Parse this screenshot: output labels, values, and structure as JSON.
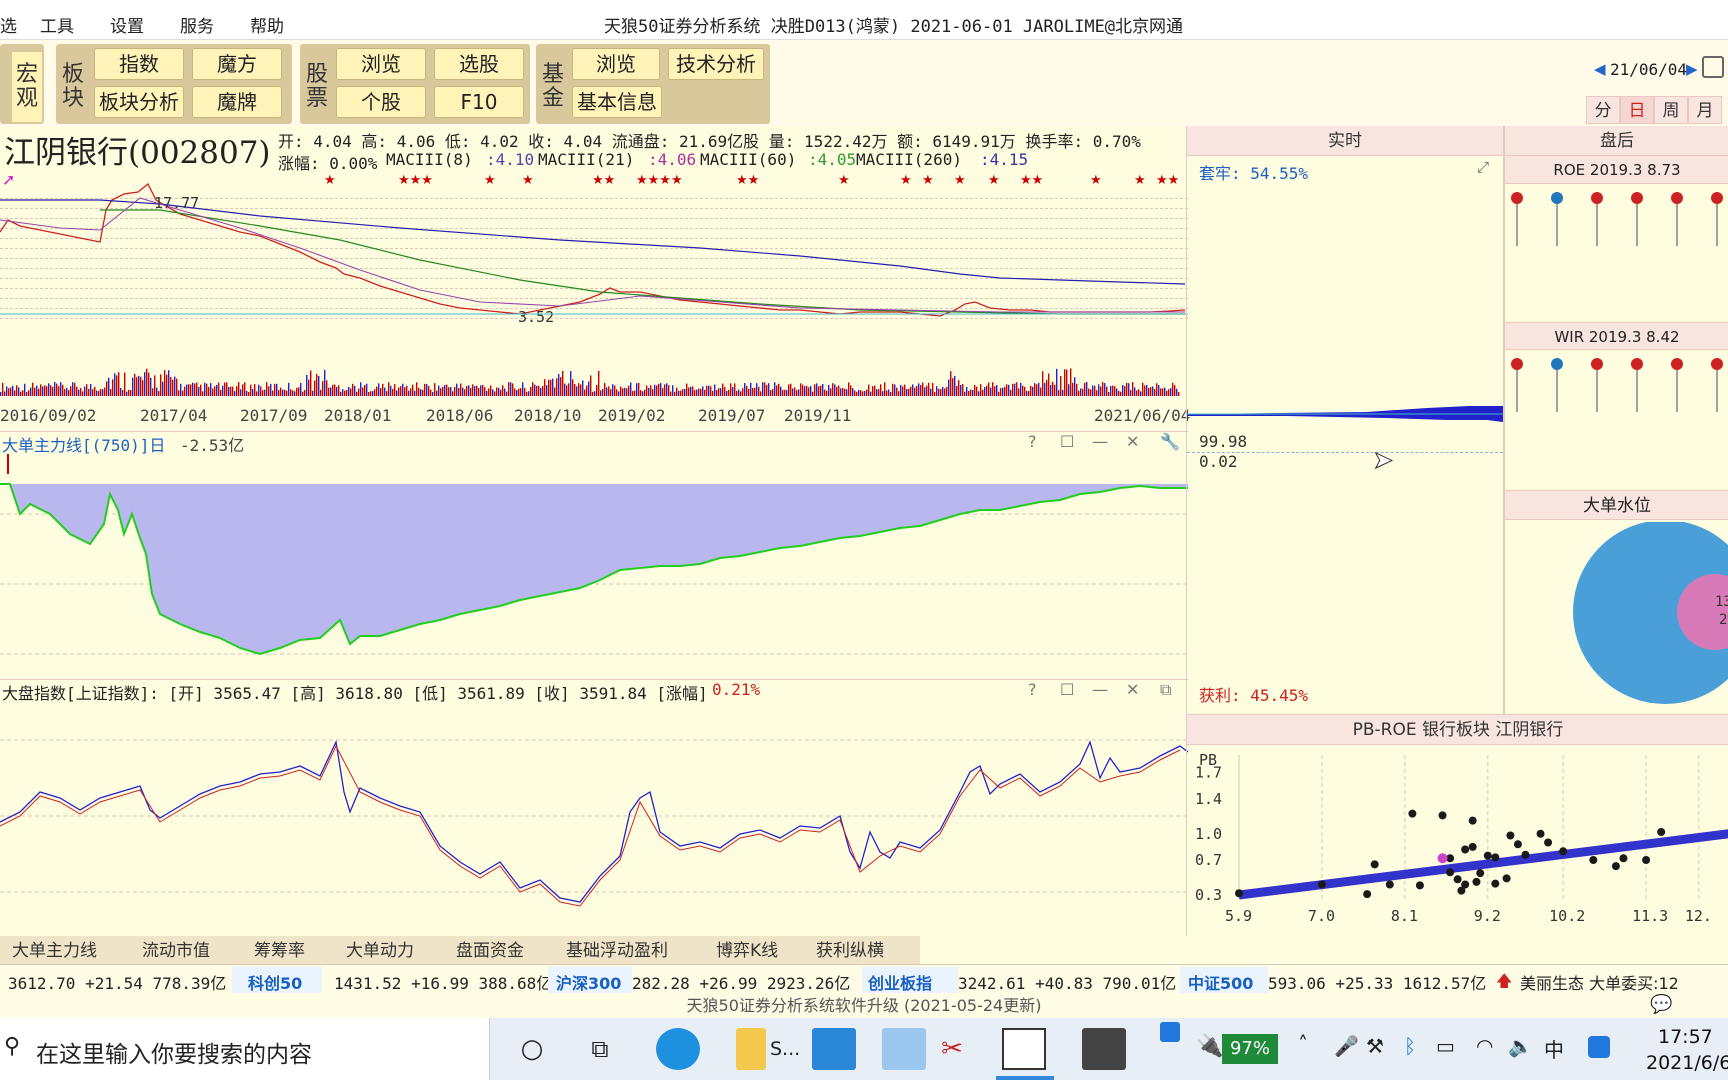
{
  "menu": {
    "items": [
      "工具",
      "设置",
      "服务",
      "帮助"
    ],
    "title": "天狼50证券分析系统  决胜D013(鸿蒙)  2021-06-01 JAROLIME@北京网通"
  },
  "toolbar": {
    "macro_label": "宏观",
    "sector_label": "板块",
    "btn_index": "指数",
    "btn_cube": "魔方",
    "btn_sector_analysis": "板块分析",
    "btn_magic_card": "魔牌",
    "stock_label": "股票",
    "btn_browse": "浏览",
    "btn_select": "选股",
    "btn_single": "个股",
    "btn_f10": "F10",
    "fund_label": "基金",
    "btn_fund_browse": "浏览",
    "btn_tech": "技术分析",
    "btn_basic_info": "基本信息",
    "date_nav": "21/06/04",
    "periods": [
      "分",
      "日",
      "周",
      "月"
    ]
  },
  "stock": {
    "name": "江阴银行(002807)",
    "line1": "开: 4.04 高: 4.06 低: 4.02 收: 4.04 流通盘: 21.69亿股 量: 1522.42万 额: 6149.91万 换手率: 0.70%",
    "change": "涨幅: 0.00%",
    "ma8_label": "MACIII(8)",
    "ma8_val": ":4.10",
    "ma21_label": "MACIII(21)",
    "ma21_val": ":4.06",
    "ma60_label": "MACIII(60)",
    "ma60_val": ":4.05",
    "ma260_label": "MACIII(260)",
    "ma260_val": ":4.15",
    "high_label": "17.77",
    "low_label": "3.52"
  },
  "xaxis": [
    "2016/09/02",
    "2017/04",
    "2017/09",
    "2018/01",
    "2018/06",
    "2018/10",
    "2019/02",
    "2019/07",
    "2019/11",
    "2021/06/04"
  ],
  "big_order": {
    "title": "大单主力线[(750)]日",
    "value": "-2.53亿"
  },
  "index_panel": {
    "title": "大盘指数[上证指数]: [开] 3565.47 [高] 3618.80 [低] 3561.89 [收] 3591.84 [涨幅]",
    "change": "0.21%"
  },
  "realtime": {
    "header": "实时",
    "trapped": "套牢: 54.55%",
    "level_hi": "99.98",
    "level_lo": "0.02",
    "profit": "获利: 45.45%"
  },
  "after": {
    "header": "盘后",
    "roe": "ROE 2019.3 8.73",
    "wir": "WIR 2019.3 8.42",
    "water_title": "大单水位",
    "pie_label_1": "13",
    "pie_label_2": "2"
  },
  "pbroe": {
    "title": "PB-ROE  银行板块  江阴银行",
    "y_title": "PB",
    "y_ticks": [
      "1.7",
      "1.4",
      "1.0",
      "0.7",
      "0.3"
    ],
    "x_ticks": [
      "5.9",
      "7.0",
      "8.1",
      "9.2",
      "10.2",
      "11.3",
      "12."
    ]
  },
  "bottom_tabs": [
    "大单主力线",
    "流动市值",
    "筹筹率",
    "大单动力",
    "盘面资金",
    "基础浮动盈利",
    "博弈K线",
    "获利纵横"
  ],
  "ticker": {
    "t1": "3612.70  +21.54  778.39亿",
    "n2": "科创50",
    "t2": "1431.52  +16.99  388.68亿",
    "n3": "沪深300",
    "t3": "282.28  +26.99  2923.26亿",
    "n4": "创业板指",
    "t4": "3242.61  +40.83  790.01亿",
    "n5": "中证500",
    "t5": "593.06  +25.33  1612.57亿",
    "t6": "美丽生态  大单委买:12"
  },
  "upgrade": "天狼50证券分析系统软件升级 (2021-05-24更新)",
  "taskbar": {
    "search_placeholder": "在这里输入你要搜索的内容",
    "app_s": "S...",
    "battery": "97%",
    "ime": "中",
    "time": "17:57",
    "date": "2021/6/6"
  },
  "colors": {
    "background": "#FFFDE0",
    "fill_blue": "#B8B8EE",
    "line_green": "#22CC22",
    "up_red": "#CC0000",
    "down_blue": "#2222CC",
    "regression": "#3333CC",
    "pie_blue": "#4A9FD8",
    "pie_pink": "#D87AB8"
  },
  "chart_data": {
    "type": "scatter",
    "title": "PB-ROE  银行板块  江阴银行",
    "ylabel": "PB",
    "xlim": [
      5.9,
      12.4
    ],
    "ylim": [
      0.3,
      1.9
    ],
    "points": [
      [
        5.9,
        0.32
      ],
      [
        7.0,
        0.42
      ],
      [
        7.6,
        0.31
      ],
      [
        7.7,
        0.65
      ],
      [
        7.9,
        0.42
      ],
      [
        8.2,
        1.23
      ],
      [
        8.3,
        0.41
      ],
      [
        8.6,
        1.21
      ],
      [
        8.7,
        0.72
      ],
      [
        8.7,
        0.56
      ],
      [
        8.8,
        0.48
      ],
      [
        8.85,
        0.35
      ],
      [
        8.9,
        0.42
      ],
      [
        8.9,
        0.82
      ],
      [
        9.0,
        0.85
      ],
      [
        9.0,
        1.15
      ],
      [
        9.05,
        0.45
      ],
      [
        9.1,
        0.55
      ],
      [
        9.2,
        0.75
      ],
      [
        9.3,
        0.73
      ],
      [
        9.3,
        0.43
      ],
      [
        9.45,
        0.49
      ],
      [
        9.5,
        0.98
      ],
      [
        9.6,
        0.88
      ],
      [
        9.7,
        0.76
      ],
      [
        9.9,
        1.0
      ],
      [
        10.0,
        0.9
      ],
      [
        10.2,
        0.8
      ],
      [
        10.6,
        0.7
      ],
      [
        10.9,
        0.63
      ],
      [
        11.0,
        0.72
      ],
      [
        11.3,
        0.7
      ],
      [
        11.5,
        1.02
      ]
    ],
    "highlight": [
      8.6,
      0.72
    ],
    "fit_line": [
      [
        5.9,
        0.3
      ],
      [
        12.4,
        1.0
      ]
    ]
  }
}
